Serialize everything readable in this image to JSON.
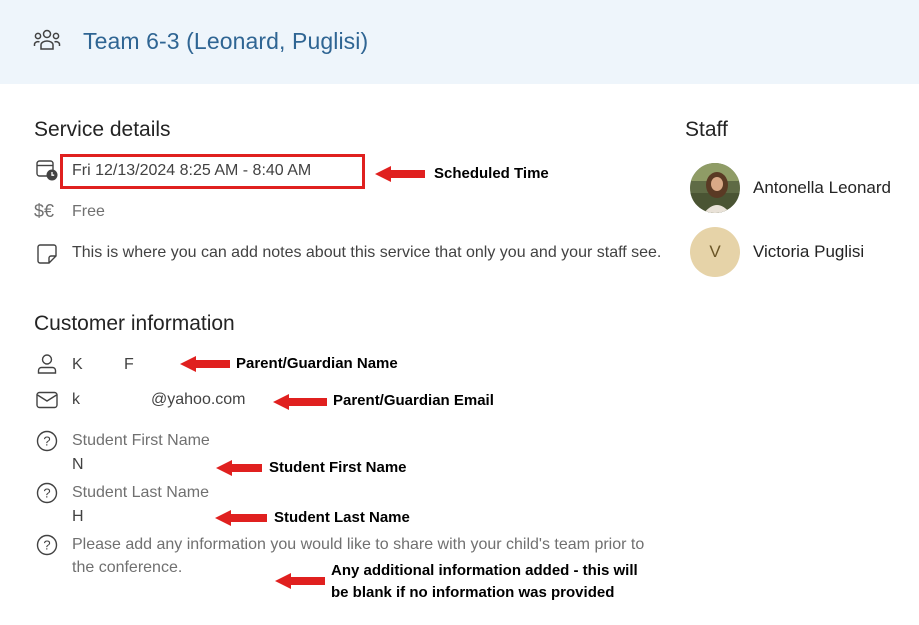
{
  "header": {
    "title": "Team 6-3 (Leonard, Puglisi)",
    "icon": "team-icon"
  },
  "service": {
    "heading": "Service details",
    "time": "Fri 12/13/2024 8:25 AM - 8:40 AM",
    "price": "Free",
    "notes": "This is where you can add notes about this service that only you and your staff see."
  },
  "customer": {
    "heading": "Customer information",
    "name_first": "K",
    "name_last": "F",
    "email_start": "k",
    "email_domain": "@yahoo.com",
    "q1_label": "Student First Name",
    "q1_answer": "N",
    "q2_label": "Student Last Name",
    "q2_answer": "H",
    "q3_label": "Please add any information you would like to share with your child's team prior to the conference."
  },
  "staff": {
    "heading": "Staff",
    "members": [
      {
        "name": "Antonella Leonard",
        "avatar": "photo"
      },
      {
        "name": "Victoria Puglisi",
        "initial": "V"
      }
    ]
  },
  "annotations": {
    "scheduled_time": "Scheduled Time",
    "parent_name": "Parent/Guardian Name",
    "parent_email": "Parent/Guardian Email",
    "student_first": "Student First Name",
    "student_last": "Student Last Name",
    "additional_line1": "Any additional information added - this will",
    "additional_line2": "be blank if no information was provided"
  },
  "colors": {
    "accent": "#2f6593",
    "header_bg": "#eef5fb",
    "annotation_red": "#e0201f"
  }
}
